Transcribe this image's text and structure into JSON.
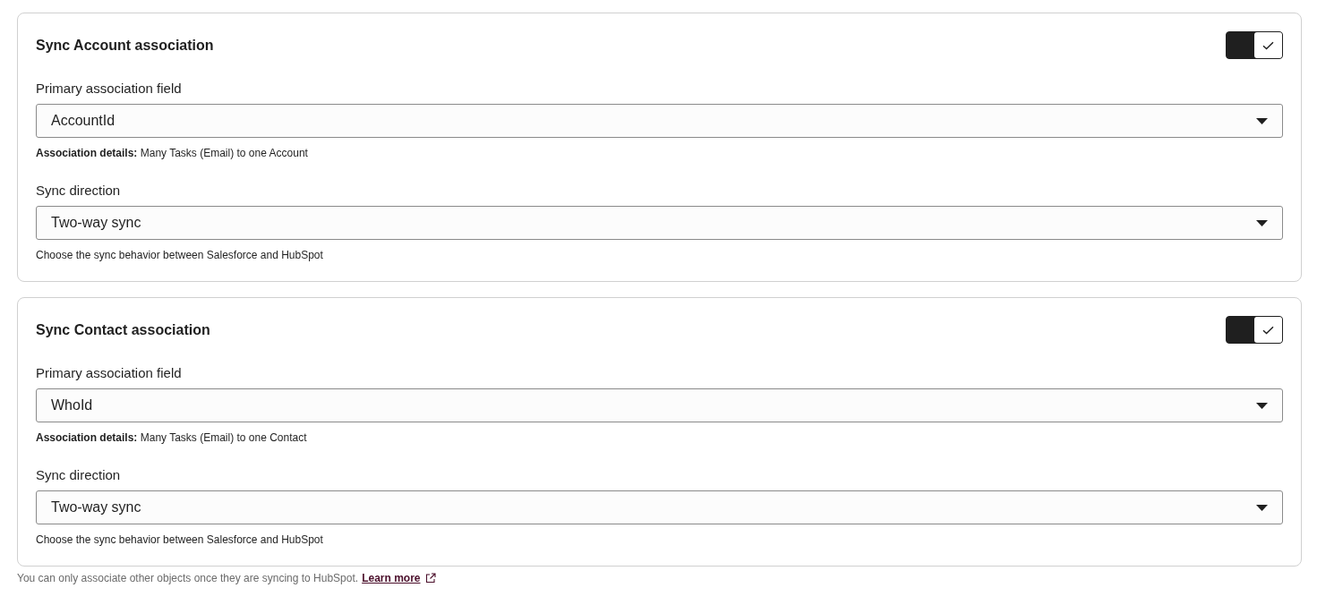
{
  "cards": [
    {
      "title": "Sync Account association",
      "toggle_on": true,
      "fields": [
        {
          "label": "Primary association field",
          "value": "AccountId",
          "note": "**Association details:** Many Tasks (Email) to one Account"
        },
        {
          "label": "Sync direction",
          "value": "Two-way sync",
          "note": "Choose the sync behavior between Salesforce and HubSpot"
        }
      ]
    },
    {
      "title": "Sync Contact association",
      "toggle_on": true,
      "fields": [
        {
          "label": "Primary association field",
          "value": "WhoId",
          "note": "**Association details:** Many Tasks (Email) to one Contact"
        },
        {
          "label": "Sync direction",
          "value": "Two-way sync",
          "note": "Choose the sync behavior between Salesforce and HubSpot"
        }
      ]
    }
  ],
  "footer": {
    "text": "You can only associate other objects once they are syncing to HubSpot.",
    "link": "Learn more"
  }
}
